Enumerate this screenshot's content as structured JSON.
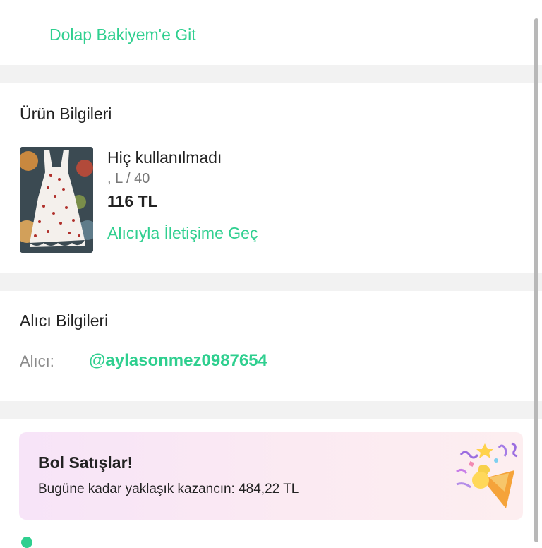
{
  "balance_link": "Dolap Bakiyem'e Git",
  "product_section": {
    "title": "Ürün Bilgileri",
    "condition": "Hiç kullanılmadı",
    "size": ", L / 40",
    "price": "116 TL",
    "contact_link": "Alıcıyla İletişime Geç",
    "image_icon": "dress-photo"
  },
  "buyer_section": {
    "title": "Alıcı Bilgileri",
    "buyer_label": "Alıcı:",
    "buyer_handle": "@aylasonmez0987654"
  },
  "promo": {
    "title": "Bol Satışlar!",
    "text": "Bugüne kadar yaklaşık kazancın: 484,22 TL",
    "icon": "party-popper-icon"
  },
  "colors": {
    "accent": "#2fcf8f",
    "separator": "#f2f2f2",
    "promo_bg": "#f7e4f8"
  }
}
